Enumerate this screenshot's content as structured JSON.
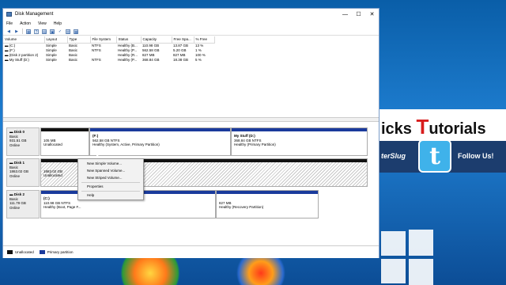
{
  "desktop": {
    "banner_title_prefix": "icks ",
    "banner_title_letter": "T",
    "banner_title_suffix": "utorials",
    "banner_sub": "terSlug",
    "follow": "Follow Us!",
    "twitter_glyph": "t"
  },
  "window": {
    "title": "Disk Management",
    "minimize": "—",
    "maximize": "☐",
    "close": "✕"
  },
  "menu": [
    "File",
    "Action",
    "View",
    "Help"
  ],
  "toolbar": [
    "◀",
    "▶",
    "▦",
    "?",
    "▤",
    "▣",
    "✓",
    "▥",
    "▦"
  ],
  "volume_table": {
    "headers": [
      "Volume",
      "Layout",
      "Type",
      "File System",
      "Status",
      "Capacity",
      "Free Spa...",
      "% Free"
    ],
    "rows": [
      [
        "(C:)",
        "Simple",
        "Basic",
        "NTFS",
        "Healthy (B...",
        "110.98 GB",
        "13.87 GB",
        "13 %"
      ],
      [
        "(F:)",
        "Simple",
        "Basic",
        "NTFS",
        "Healthy (P...",
        "562.58 GB",
        "5.20 GB",
        "1 %"
      ],
      [
        "(Disk 2 partition 2)",
        "Simple",
        "Basic",
        "",
        "Healthy (R...",
        "827 MB",
        "827 MB",
        "100 %"
      ],
      [
        "My Stuff (D:)",
        "Simple",
        "Basic",
        "NTFS",
        "Healthy (P...",
        "368.84 GB",
        "18.38 GB",
        "5 %"
      ]
    ]
  },
  "disks": {
    "disk0": {
      "name": "Disk 0",
      "type": "Basic",
      "size": "931.51 GB",
      "status": "Online",
      "p1": {
        "size": "105 MB",
        "status": "Unallocated"
      },
      "p2": {
        "name": "(F:)",
        "size": "562.58 GB NTFS",
        "status": "Healthy (System, Active, Primary Partition)"
      },
      "p3": {
        "name": "My Stuff (D:)",
        "size": "368.84 GB NTFS",
        "status": "Healthy (Primary Partition)"
      }
    },
    "disk1": {
      "name": "Disk 1",
      "type": "Basic",
      "size": "1863.02 GB",
      "status": "Online",
      "p1": {
        "size": "1863.02 GB",
        "status": "Unallocated"
      }
    },
    "disk2": {
      "name": "Disk 2",
      "type": "Basic",
      "size": "111.79 GB",
      "status": "Online",
      "p1": {
        "name": "(C:)",
        "size": "110.98 GB NTFS",
        "status": "Healthy (Boot, Page F..."
      },
      "p2": {
        "size": "827 MB",
        "status": "Healthy (Recovery Partition)"
      }
    }
  },
  "context_menu": {
    "items": [
      "New Simple Volume...",
      "New Spanned Volume...",
      "New Striped Volume...",
      "Properties",
      "Help"
    ]
  },
  "legend": {
    "unallocated": "Unallocated",
    "primary": "Primary partition"
  },
  "colors": {
    "unallocated": "#111111",
    "primary": "#1a3a9c"
  }
}
